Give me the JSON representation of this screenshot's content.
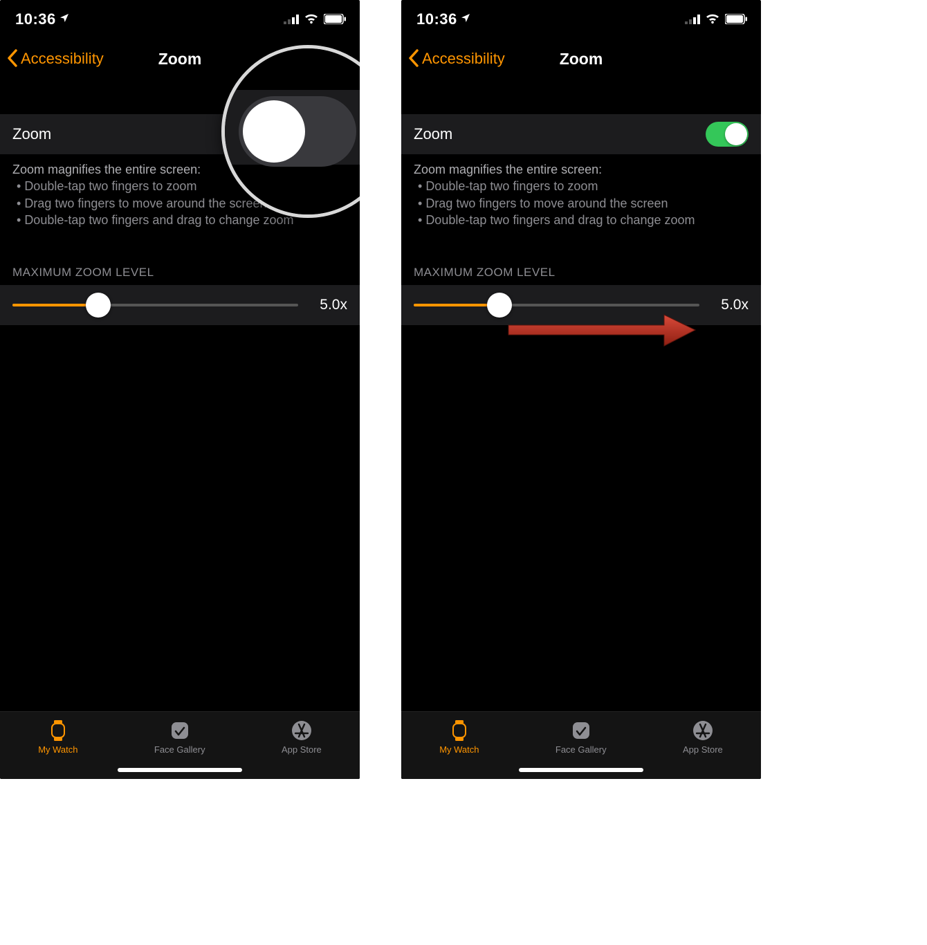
{
  "status": {
    "time": "10:36"
  },
  "nav": {
    "back_label": "Accessibility",
    "title": "Zoom"
  },
  "zoom_row": {
    "label": "Zoom",
    "left_on": false,
    "right_on": true
  },
  "hint": {
    "title": "Zoom magnifies the entire screen:",
    "items": [
      "Double-tap two fingers to zoom",
      "Drag two fingers to move around the screen",
      "Double-tap two fingers and drag to change zoom"
    ]
  },
  "slider": {
    "header": "MAXIMUM ZOOM LEVEL",
    "value_label": "5.0x",
    "fill_percent": 30
  },
  "tabs": [
    {
      "label": "My Watch",
      "active": true
    },
    {
      "label": "Face Gallery",
      "active": false
    },
    {
      "label": "App Store",
      "active": false
    }
  ]
}
